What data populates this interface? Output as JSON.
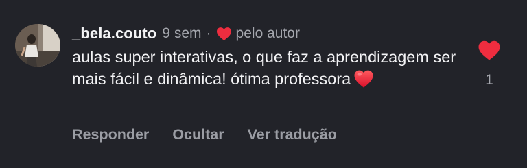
{
  "comment": {
    "username": "_bela.couto",
    "time": "9 sem",
    "separator": "·",
    "liked_by_label": "pelo autor",
    "text": "aulas super interativas, o que faz a aprendizagem ser mais fácil e dinâmica! ótima professora",
    "text_emoji": "red-heart-emoji",
    "like_count": "1",
    "liked": true
  },
  "actions": {
    "reply": "Responder",
    "hide": "Ocultar",
    "translate": "Ver tradução"
  },
  "icons": {
    "avatar": "user-avatar-photo",
    "author_like": "heart-icon",
    "like_button": "heart-icon"
  },
  "colors": {
    "background": "#222329",
    "text_primary": "#f3f3f5",
    "text_secondary": "#a5a7ae",
    "heart_red": "#ee2d3f"
  }
}
